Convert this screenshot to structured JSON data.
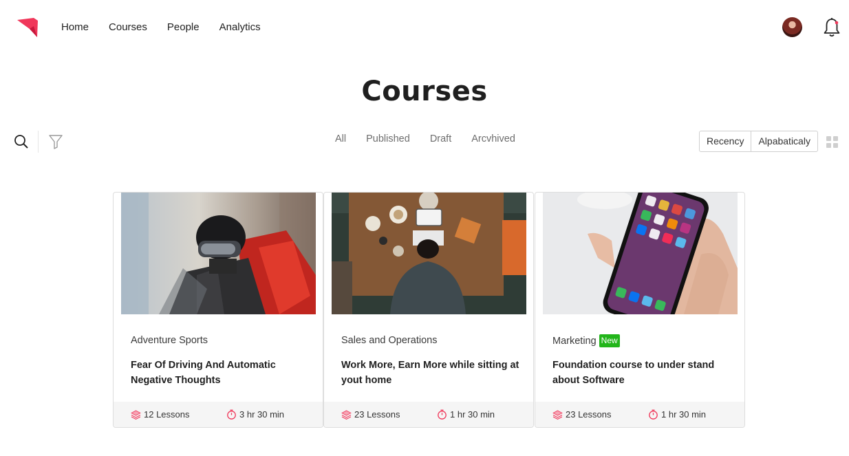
{
  "nav": {
    "items": [
      {
        "label": "Home"
      },
      {
        "label": "Courses"
      },
      {
        "label": "People"
      },
      {
        "label": "Analytics"
      }
    ]
  },
  "header": {
    "logo_icon": "ribbon-logo-icon",
    "avatar_icon": "user-avatar",
    "bell_icon": "bell-icon"
  },
  "page": {
    "title": "Courses"
  },
  "toolbar": {
    "search_icon": "search-icon",
    "filter_icon": "filter-icon",
    "tabs": [
      {
        "label": "All"
      },
      {
        "label": "Published"
      },
      {
        "label": "Draft"
      },
      {
        "label": "Arcvhived"
      }
    ],
    "sort": [
      {
        "label": "Recency"
      },
      {
        "label": "Alpabaticaly"
      }
    ],
    "grid_view_icon": "grid-view-icon"
  },
  "colors": {
    "brand": "#f0375a",
    "badge": "#22b51a",
    "meta_icon": "#f0375a"
  },
  "courses": [
    {
      "category": "Adventure Sports",
      "badge": "",
      "title": "Fear Of Driving And Automatic Negative Thoughts",
      "lessons": "12 Lessons",
      "duration": "3 hr 30 min",
      "image": "motorcyclist-photo"
    },
    {
      "category": "Sales and Operations",
      "badge": "",
      "title": "Work More, Earn More while sitting at yout home",
      "lessons": "23 Lessons",
      "duration": "1 hr 30 min",
      "image": "desk-laptop-photo"
    },
    {
      "category": "Marketing",
      "badge": "New",
      "title": "Foundation course to under stand about Software",
      "lessons": "23 Lessons",
      "duration": "1 hr 30 min",
      "image": "smartphone-hand-photo"
    }
  ]
}
